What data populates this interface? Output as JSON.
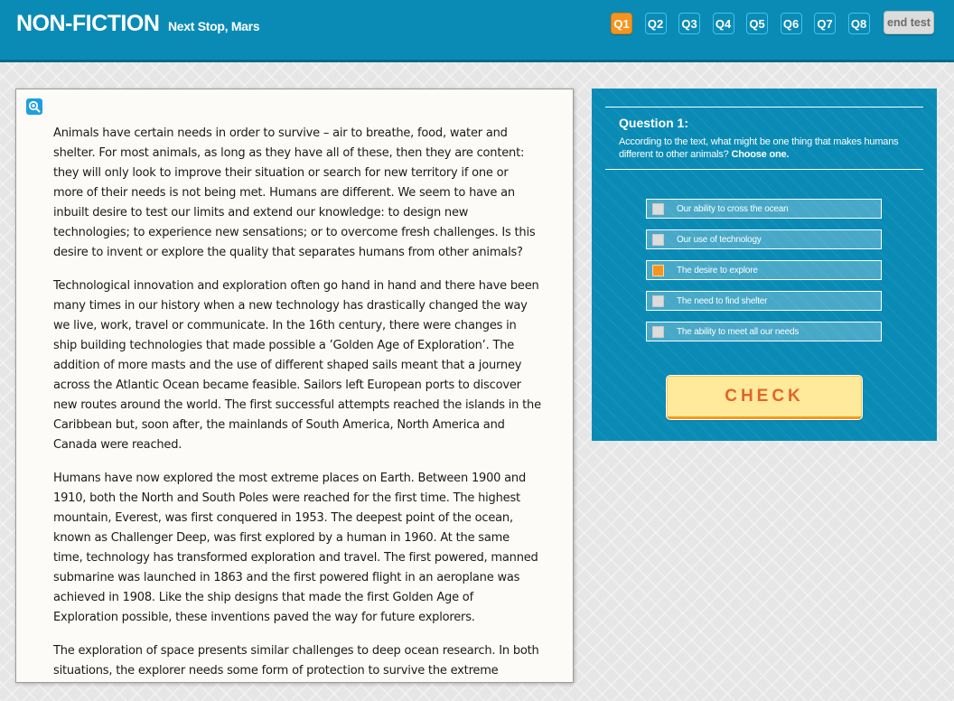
{
  "header": {
    "brand": "NON-FICTION",
    "subtitle": "Next Stop, Mars",
    "questions": [
      "Q1",
      "Q2",
      "Q3",
      "Q4",
      "Q5",
      "Q6",
      "Q7",
      "Q8"
    ],
    "active_question": "Q1",
    "end_test_label": "end test"
  },
  "passage": {
    "zoom_icon": "zoom-in-icon",
    "paragraphs": [
      "Animals have certain needs in order to survive – air to breathe, food, water and shelter. For most animals, as long as they have all of these, then they are content: they will only look to improve their situation or search for new territory if one or more of their needs is not being met. Humans are different. We seem to have an inbuilt desire to test our limits and extend our knowledge: to design new technologies; to experience new sensations; or to overcome fresh challenges. Is this desire to invent or explore the quality that separates humans from other animals?",
      "Technological innovation and exploration often go hand in hand and there have been many times in our history when a new technology has drastically changed the way we live, work, travel or communicate. In the 16th century, there were changes in ship building technologies that made possible a ’Golden Age of Exploration’. The addition of more masts and the use of different shaped sails meant that a journey across the Atlantic Ocean became feasible. Sailors left European ports to discover new routes around the world. The first successful attempts reached the islands in the Caribbean but, soon after, the mainlands of South America, North America and Canada were reached.",
      "Humans have now explored the most extreme places on Earth. Between 1900 and 1910, both the North and South Poles were reached for the first time. The highest mountain, Everest, was first conquered in 1953. The deepest point of the ocean, known as Challenger Deep, was first explored by a human in 1960. At the same time, technology has transformed exploration and travel. The first powered, manned submarine was launched in 1863 and the first powered flight in an aeroplane was achieved in 1908. Like the ship designs that made the first Golden Age of Exploration possible, these inventions paved the way for future explorers.",
      "The exploration of space presents similar challenges to deep ocean research. In both situations, the explorer needs some form of protection to survive the extreme"
    ]
  },
  "question": {
    "title": "Question 1:",
    "prompt": "According to the text, what might be one thing that makes humans different to other animals?",
    "instruction": "Choose one.",
    "options": [
      {
        "label": "Our ability to cross the ocean",
        "selected": false
      },
      {
        "label": "Our use of technology",
        "selected": false
      },
      {
        "label": "The desire to explore",
        "selected": true
      },
      {
        "label": "The need to find shelter",
        "selected": false
      },
      {
        "label": "The ability to meet all our needs",
        "selected": false
      }
    ],
    "check_label": "CHECK"
  },
  "colors": {
    "header_bg": "#0a8bb5",
    "active_question": "#f7941d",
    "selected_option": "#f7941d",
    "check_text": "#e0662a",
    "check_bg": "#ffe99a"
  }
}
